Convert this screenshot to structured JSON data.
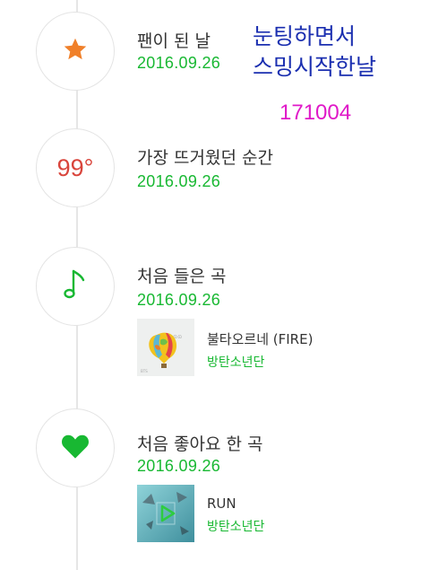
{
  "milestones": [
    {
      "title": "팬이 된 날",
      "date": "2016.09.26",
      "icon": "star-icon"
    },
    {
      "title": "가장 뜨거웠던 순간",
      "date": "2016.09.26",
      "icon_text": "99°"
    },
    {
      "title": "처음 들은 곡",
      "date": "2016.09.26",
      "icon": "music-note-icon",
      "track": {
        "title": "불타오르네 (FIRE)",
        "artist": "방탄소년단"
      }
    },
    {
      "title": "처음 좋아요 한 곡",
      "date": "2016.09.26",
      "icon": "heart-icon",
      "track": {
        "title": "RUN",
        "artist": "방탄소년단"
      }
    }
  ],
  "annotations": {
    "handwritten_line1": "눈팅하면서",
    "handwritten_line2": "스밍시작한날",
    "handwritten_number": "171004"
  },
  "colors": {
    "accent_green": "#18b832",
    "star_orange": "#f0802a",
    "degree_red": "#d9453c",
    "annotation_blue": "#1b2fb0",
    "annotation_magenta": "#e019c8"
  }
}
